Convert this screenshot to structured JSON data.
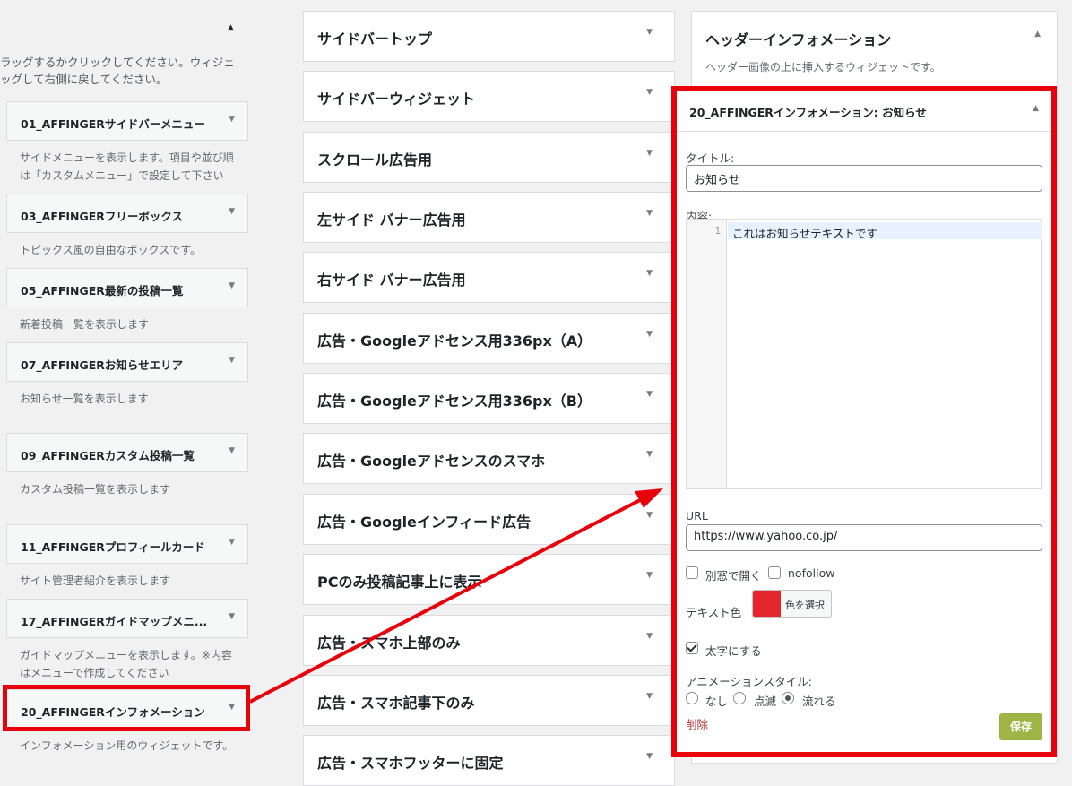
{
  "left": {
    "intro_line1": "ラッグするかクリックしてください。ウィジェ",
    "intro_line2": "ッグして右側に戻してください。",
    "widgets": [
      {
        "title": "01_AFFINGERサイドバーメニュー",
        "desc1": "サイドメニューを表示します。項目や並び順",
        "desc2": "は「カスタムメニュー」で設定して下さい"
      },
      {
        "title": "03_AFFINGERフリーボックス",
        "desc1": "トピックス風の自由なボックスです。",
        "desc2": ""
      },
      {
        "title": "05_AFFINGER最新の投稿一覧",
        "desc1": "新着投稿一覧を表示します",
        "desc2": ""
      },
      {
        "title": "07_AFFINGERお知らせエリア",
        "desc1": "お知らせ一覧を表示します",
        "desc2": ""
      },
      {
        "title": "09_AFFINGERカスタム投稿一覧",
        "desc1": "カスタム投稿一覧を表示します",
        "desc2": ""
      },
      {
        "title": "11_AFFINGERプロフィールカード",
        "desc1": "サイト管理者紹介を表示します",
        "desc2": ""
      },
      {
        "title": "17_AFFINGERガイドマップメニ...",
        "desc1": "ガイドマップメニューを表示します。※内容",
        "desc2": "はメニューで作成してください"
      },
      {
        "title": "20_AFFINGERインフォメーション",
        "desc1": "インフォメーション用のウィジェットです。",
        "desc2": ""
      }
    ]
  },
  "middle": {
    "areas": [
      "サイドバートップ",
      "サイドバーウィジェット",
      "スクロール広告用",
      "左サイド バナー広告用",
      "右サイド バナー広告用",
      "広告・Googleアドセンス用336px（A）",
      "広告・Googleアドセンス用336px（B）",
      "広告・Googleアドセンスのスマホ",
      "広告・Googleインフィード広告",
      "PCのみ投稿記事上に表示",
      "広告・スマホ上部のみ",
      "広告・スマホ記事下のみ",
      "広告・スマホフッターに固定"
    ]
  },
  "right": {
    "area_title": "ヘッダーインフォメーション",
    "area_desc": "ヘッダー画像の上に挿入するウィジェットです。",
    "editor": {
      "title": "20_AFFINGERインフォメーション: お知らせ",
      "title_label": "タイトル:",
      "title_value": "お知らせ",
      "content_label": "内容:",
      "line_number": "1",
      "content_text": "これはお知らせテキストです",
      "url_label": "URL",
      "url_value": "https://www.yahoo.co.jp/",
      "new_window_label": "別窓で開く",
      "nofollow_label": "nofollow",
      "text_color_label": "テキスト色",
      "color_button_label": "色を選択",
      "text_color": "#e3262c",
      "bold_label": "太字にする",
      "animation_label": "アニメーションスタイル:",
      "anim_none": "なし",
      "anim_blink": "点滅",
      "anim_flow": "流れる",
      "delete_label": "削除",
      "save_label": "保存"
    }
  },
  "colors": {
    "highlight": "#e8000b",
    "save_button": "#a0b546"
  }
}
